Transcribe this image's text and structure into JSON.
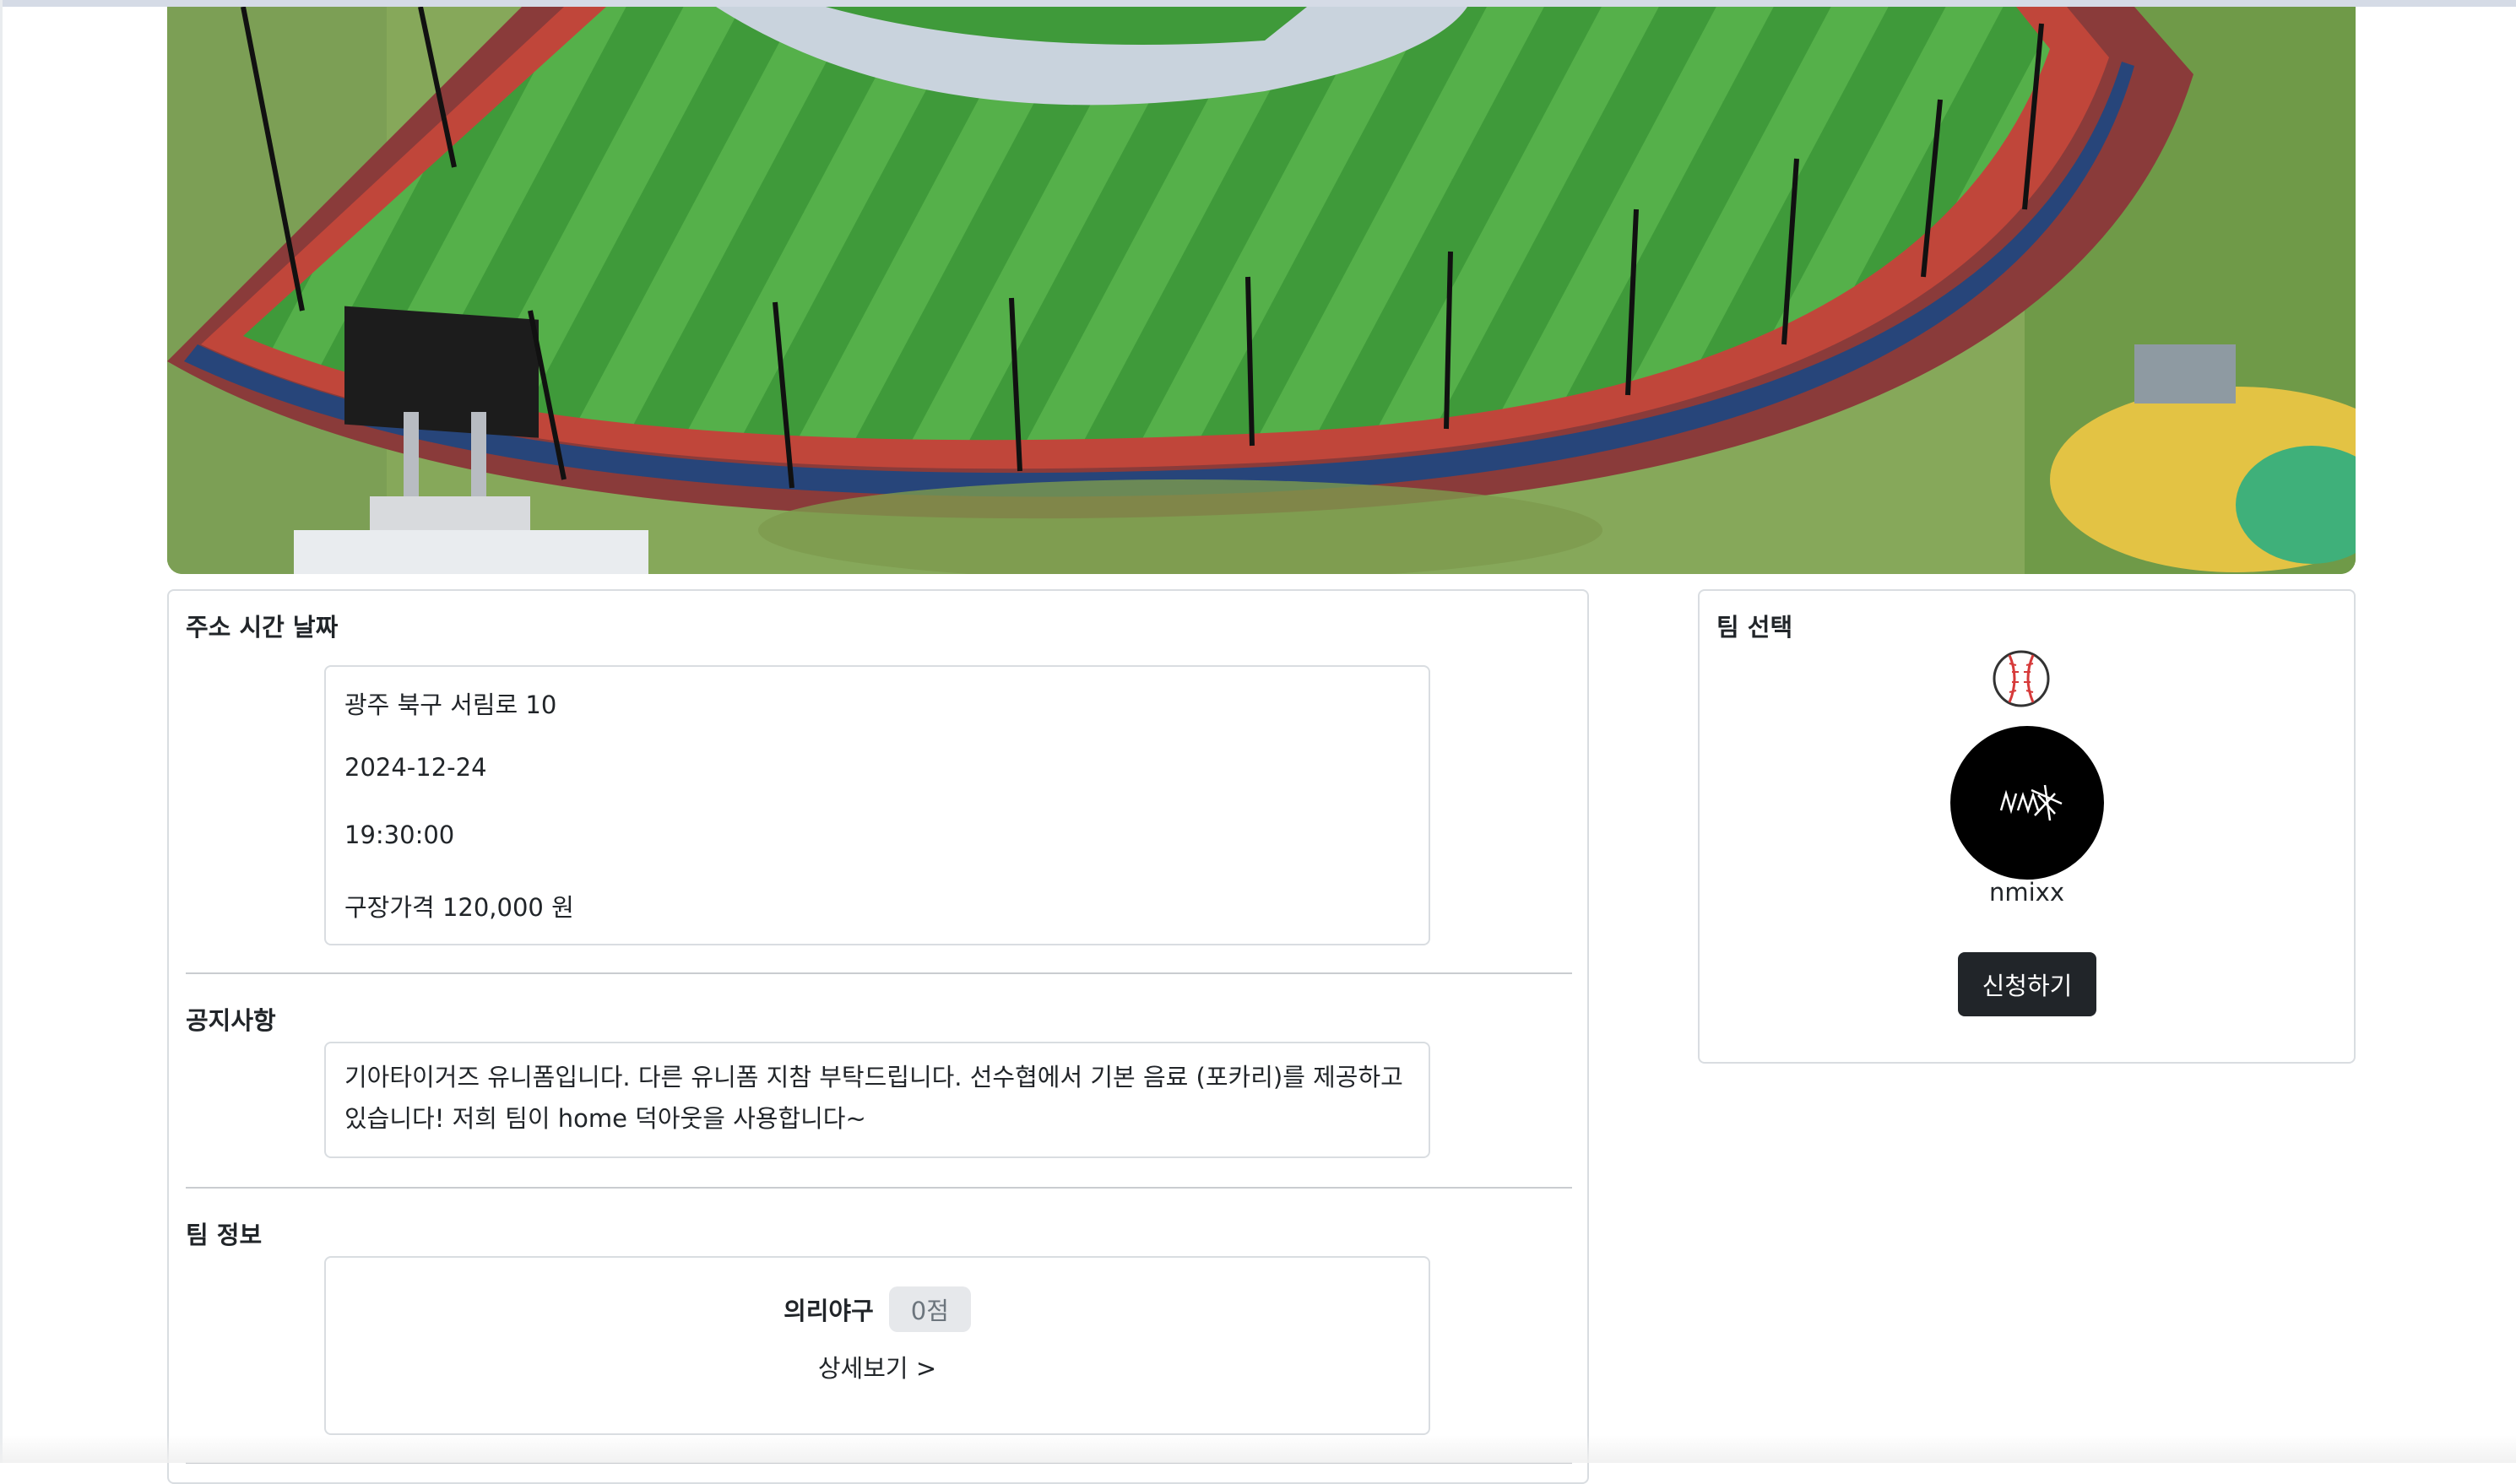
{
  "hero": {
    "alt": "야구장 전경"
  },
  "info_section": {
    "title": "주소 시간 날짜",
    "address": "광주 북구 서림로 10",
    "date": "2024-12-24",
    "time": "19:30:00",
    "price": "구장가격 120,000 원"
  },
  "notice_section": {
    "title": "공지사항",
    "text": "기아타이거즈 유니폼입니다. 다른 유니폼 지참 부탁드립니다. 선수협에서 기본 음료 (포카리)를 제공하고 있습니다! 저희 팀이 home 덕아웃을 사용합니다~"
  },
  "team_info_section": {
    "title": "팀 정보",
    "team_name": "의리야구",
    "score": "0점",
    "detail_link": "상세보기 >"
  },
  "team_select": {
    "title": "팀 선택",
    "ball_icon": "baseball-icon",
    "team_name": "nmixx",
    "apply_button": "신청하기"
  },
  "colors": {
    "button_bg": "#212529",
    "border": "#d9dde1",
    "badge_bg": "#e6e8eb"
  }
}
